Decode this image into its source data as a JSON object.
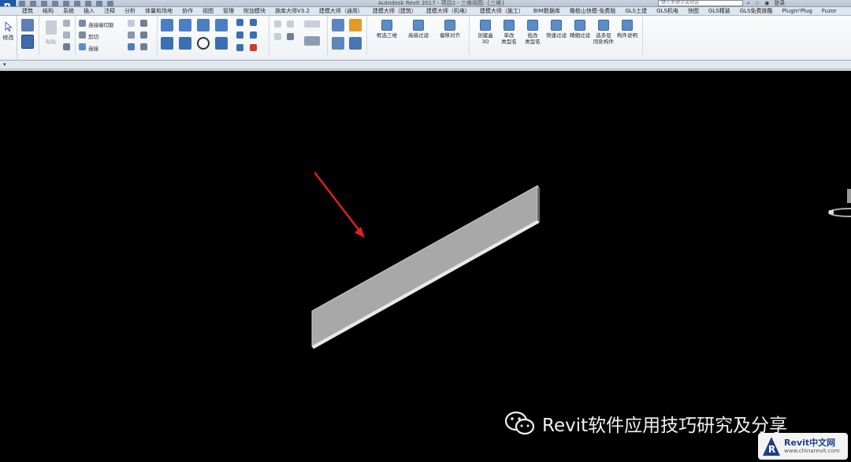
{
  "titlebar": {
    "logo_letter": "R",
    "window_title": "Autodesk Revit 2017 -    项目2 - 三维视图: {三维}",
    "search_placeholder": "键入关键字或短语",
    "signin": "登录"
  },
  "tabs": [
    "建筑",
    "结构",
    "系统",
    "插入",
    "注释",
    "分析",
    "体量和场地",
    "协作",
    "视图",
    "管理",
    "附加模块",
    "族库大师V3.2",
    "建模大师（通用）",
    "建模大师（建筑）",
    "建模大师（机电）",
    "建模大师（施工）",
    "BIM数据库",
    "橄榄山快模-免费版",
    "GLS土建",
    "GLS机电",
    "快图",
    "GLS精装",
    "GLS免费族酷",
    "Plugin'Plug",
    "Fuzor"
  ],
  "ribbon": {
    "modify_label": "修改",
    "paste_label": "粘贴",
    "join_cut_label": "连接端切割",
    "cut_label": "剪切",
    "join_label": "连接",
    "tools": [
      {
        "label": "框选三维",
        "icon": "box-3d-icon"
      },
      {
        "label": "高级过滤",
        "icon": "advanced-filter-icon"
      },
      {
        "label": "偏移对齐",
        "icon": "offset-align-icon"
      }
    ],
    "tools2": [
      {
        "label": "创建盒3D",
        "icon": "section-box-icon"
      },
      {
        "label": "单改\n类型名",
        "icon": "rename-type-icon"
      },
      {
        "label": "批改\n类型名",
        "icon": "batch-rename-icon"
      },
      {
        "label": "快速过滤",
        "icon": "quick-filter-icon"
      },
      {
        "label": "精细过滤",
        "icon": "fine-filter-icon"
      },
      {
        "label": "选多层\n同处构件",
        "icon": "multi-level-select-icon"
      },
      {
        "label": "构件说明",
        "icon": "component-notes-icon"
      }
    ]
  },
  "watermark": {
    "text": "Revit软件应用技巧研究及分享"
  },
  "badge": {
    "line1": "Revit中文网",
    "line2": "www.chinarevit.com"
  },
  "colors": {
    "canvas": "#000000",
    "panel_fill": "#a9a9a9",
    "arrow": "#e0201b"
  }
}
